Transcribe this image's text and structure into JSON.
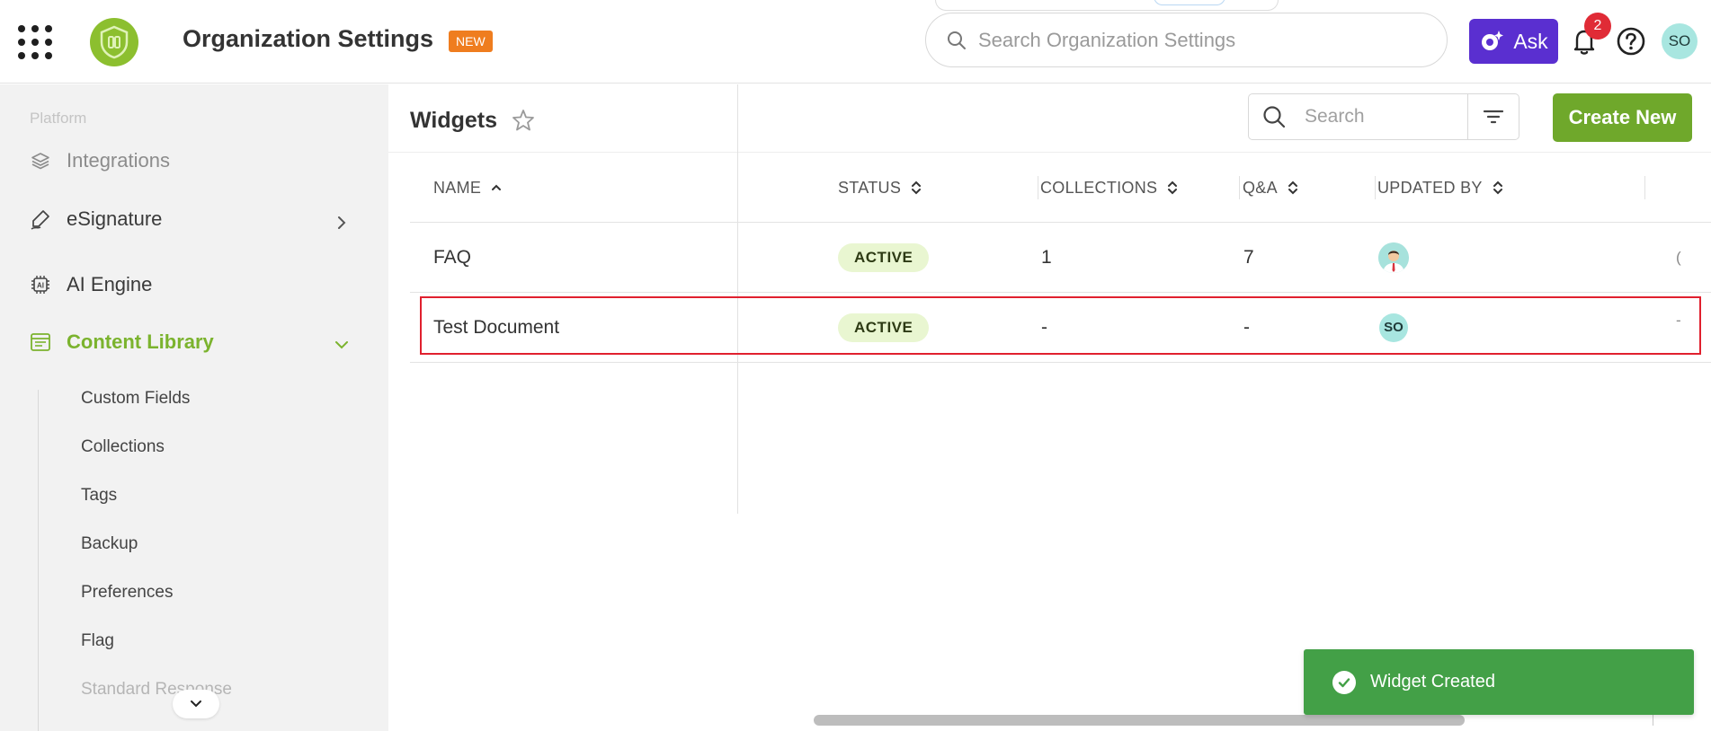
{
  "header": {
    "title": "Organization Settings",
    "badge": "NEW",
    "search_placeholder": "Search Organization Settings",
    "ask_label": "Ask",
    "notification_count": "2",
    "user_initials": "SO"
  },
  "sidebar": {
    "section_label": "Platform",
    "items": [
      {
        "label": "Integrations",
        "icon": "layers-icon"
      },
      {
        "label": "eSignature",
        "icon": "signature-pen-icon"
      },
      {
        "label": "AI Engine",
        "icon": "ai-chip-icon"
      },
      {
        "label": "Content Library",
        "icon": "library-icon"
      }
    ],
    "sub_items": [
      "Custom Fields",
      "Collections",
      "Tags",
      "Backup",
      "Preferences",
      "Flag",
      "Standard Response"
    ]
  },
  "main": {
    "title": "Widgets",
    "search_placeholder": "Search",
    "create_label": "Create New",
    "columns": [
      "NAME",
      "STATUS",
      "COLLECTIONS",
      "Q&A",
      "UPDATED BY"
    ],
    "rows": [
      {
        "name": "FAQ",
        "status": "ACTIVE",
        "collections": "1",
        "qa": "7",
        "updated_by": "avatar-image",
        "trailing": "("
      },
      {
        "name": "Test Document",
        "status": "ACTIVE",
        "collections": "-",
        "qa": "-",
        "updated_by": "SO",
        "trailing": "-"
      }
    ]
  },
  "toast": {
    "message": "Widget Created"
  },
  "colors": {
    "brand_green": "#6fa82b",
    "ask_purple": "#5a2fd0",
    "badge_orange": "#ef7d1f",
    "toast_green": "#43a047",
    "highlight_red": "#e0202e"
  }
}
